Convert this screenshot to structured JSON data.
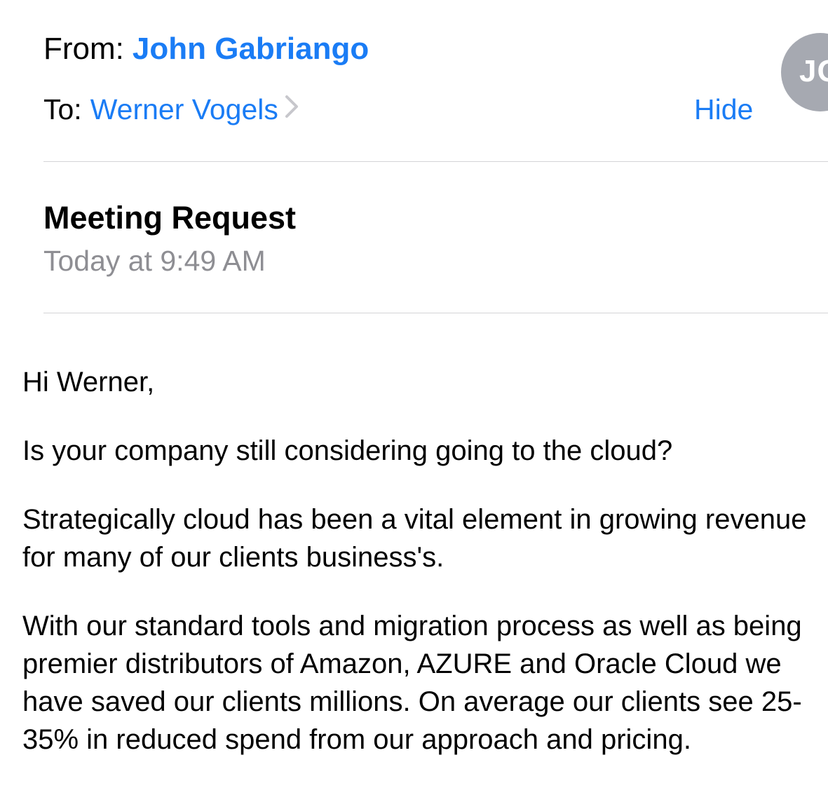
{
  "header": {
    "from_label": "From:",
    "from_name": "John Gabriango",
    "to_label": "To:",
    "to_name": "Werner Vogels",
    "hide_label": "Hide",
    "avatar_initials": "JG"
  },
  "message": {
    "subject": "Meeting Request",
    "date": "Today at 9:49 AM"
  },
  "body": {
    "greeting": "Hi Werner,",
    "paragraphs": [
      "Is your company still considering going to the cloud?",
      "Strategically cloud has been a vital element in growing revenue for many of our clients business's.",
      "With our standard tools and migration process as well as being premier distributors of Amazon, AZURE and Oracle Cloud we have saved our clients millions. On average our clients see 25-35% in reduced spend from our approach and pricing."
    ]
  },
  "colors": {
    "link": "#1a7cf5",
    "secondary_text": "#8e8e93",
    "avatar_bg": "#a6a9b1",
    "divider": "#d4d4d6"
  },
  "icons": {
    "recipient_chevron": "chevron-right-icon"
  }
}
